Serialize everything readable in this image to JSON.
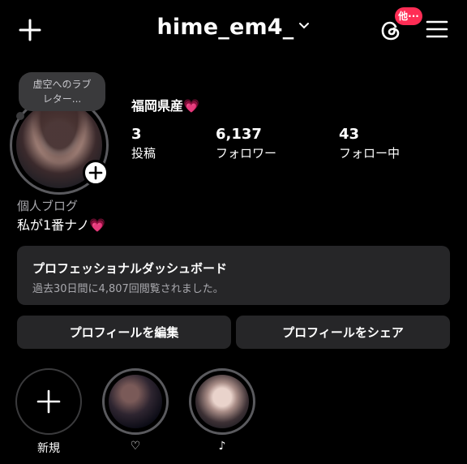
{
  "header": {
    "username": "hime_em4_",
    "threads_badge": "他···"
  },
  "profile": {
    "note": "虚空へのラブレター...",
    "location_line": "福岡県産💗",
    "category": "個人ブログ",
    "bio": "私が1番ナノ💗",
    "stats": [
      {
        "value": "3",
        "label": "投稿"
      },
      {
        "value": "6,137",
        "label": "フォロワー"
      },
      {
        "value": "43",
        "label": "フォロー中"
      }
    ]
  },
  "dashboard": {
    "title": "プロフェッショナルダッシュボード",
    "subtitle": "過去30日間に4,807回閲覧されました。"
  },
  "buttons": {
    "edit": "プロフィールを編集",
    "share": "プロフィールをシェア"
  },
  "highlights": [
    {
      "label": "新規"
    },
    {
      "label": "♡"
    },
    {
      "label": "♪"
    }
  ],
  "colors": {
    "background": "#000000",
    "card": "#262628",
    "badge": "#ff2d55",
    "secondary_text": "#a8a8ad"
  }
}
